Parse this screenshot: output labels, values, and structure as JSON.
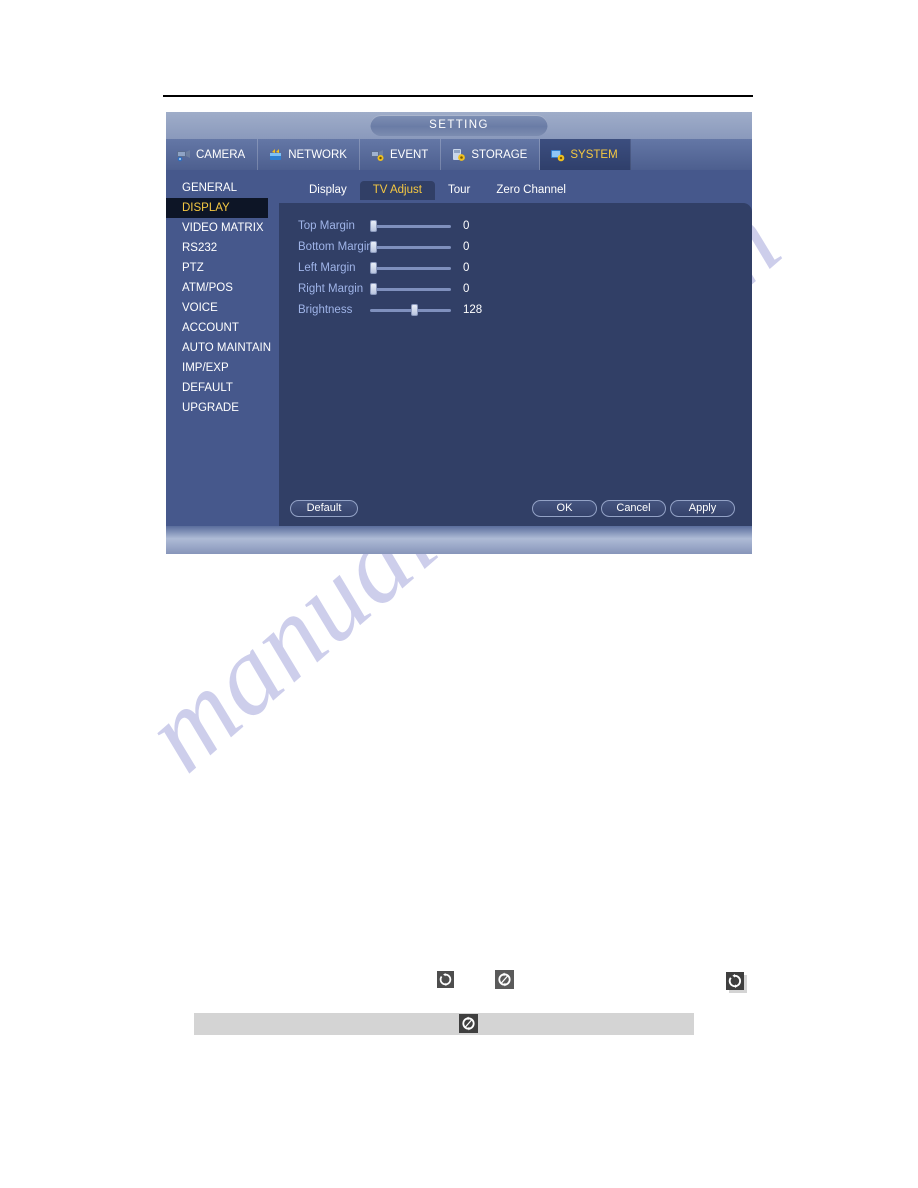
{
  "window": {
    "title": "SETTING"
  },
  "nav_tabs": [
    {
      "label": "CAMERA",
      "icon": "camera-icon",
      "active": false
    },
    {
      "label": "NETWORK",
      "icon": "network-icon",
      "active": false
    },
    {
      "label": "EVENT",
      "icon": "event-icon",
      "active": false
    },
    {
      "label": "STORAGE",
      "icon": "storage-icon",
      "active": false
    },
    {
      "label": "SYSTEM",
      "icon": "system-icon",
      "active": true
    }
  ],
  "sidebar": {
    "items": [
      {
        "label": "GENERAL",
        "active": false
      },
      {
        "label": "DISPLAY",
        "active": true
      },
      {
        "label": "VIDEO MATRIX",
        "active": false
      },
      {
        "label": "RS232",
        "active": false
      },
      {
        "label": "PTZ",
        "active": false
      },
      {
        "label": "ATM/POS",
        "active": false
      },
      {
        "label": "VOICE",
        "active": false
      },
      {
        "label": "ACCOUNT",
        "active": false
      },
      {
        "label": "AUTO MAINTAIN",
        "active": false
      },
      {
        "label": "IMP/EXP",
        "active": false
      },
      {
        "label": "DEFAULT",
        "active": false
      },
      {
        "label": "UPGRADE",
        "active": false
      }
    ]
  },
  "sub_tabs": [
    {
      "label": "Display",
      "active": false
    },
    {
      "label": "TV Adjust",
      "active": true
    },
    {
      "label": "Tour",
      "active": false
    },
    {
      "label": "Zero Channel",
      "active": false
    }
  ],
  "sliders": [
    {
      "label": "Top Margin",
      "value": "0",
      "percent": 0
    },
    {
      "label": "Bottom Margin",
      "value": "0",
      "percent": 0
    },
    {
      "label": "Left Margin",
      "value": "0",
      "percent": 0
    },
    {
      "label": "Right Margin",
      "value": "0",
      "percent": 0
    },
    {
      "label": "Brightness",
      "value": "128",
      "percent": 55
    }
  ],
  "buttons": {
    "default_label": "Default",
    "ok_label": "OK",
    "cancel_label": "Cancel",
    "apply_label": "Apply"
  },
  "doc_icons": [
    {
      "name": "rotate-icon-1"
    },
    {
      "name": "rotate-icon-2"
    },
    {
      "name": "rotate-icon-3"
    },
    {
      "name": "rotate-icon-bar"
    }
  ],
  "watermark": {
    "text": "manualshive.com"
  },
  "colors": {
    "accent_gold": "#f5c842",
    "panel_dark": "#313f66",
    "panel_mid": "#46588c",
    "label_blue": "#9fb4e8"
  }
}
